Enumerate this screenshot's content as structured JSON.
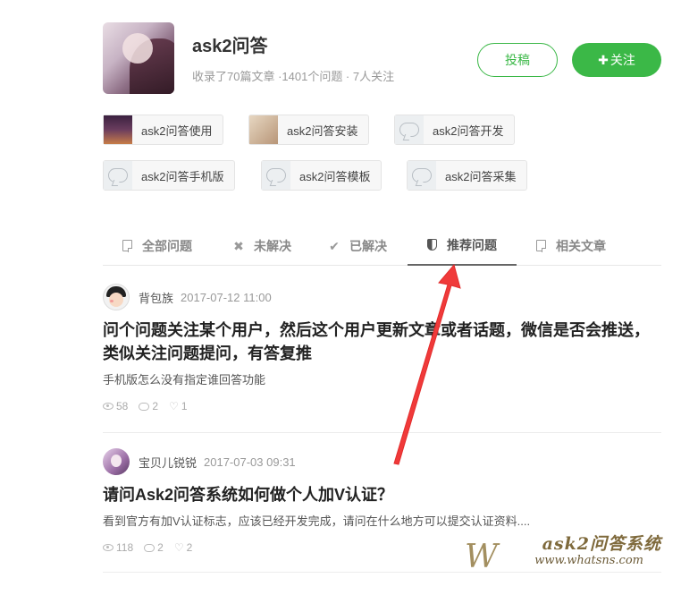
{
  "header": {
    "title": "ask2问答",
    "subtitle": "收录了70篇文章 ·1401个问题 · 7人关注",
    "contribute_label": "投稿",
    "follow_label": "关注",
    "follow_icon": "plus-icon"
  },
  "topics": [
    {
      "label": "ask2问答使用",
      "thumb": "night-scene"
    },
    {
      "label": "ask2问答安装",
      "thumb": "room-photo"
    },
    {
      "label": "ask2问答开发",
      "thumb": "chat-bubble-icon"
    },
    {
      "label": "ask2问答手机版",
      "thumb": "chat-bubble-icon"
    },
    {
      "label": "ask2问答模板",
      "thumb": "chat-bubble-icon"
    },
    {
      "label": "ask2问答采集",
      "thumb": "chat-bubble-icon"
    }
  ],
  "tabs": [
    {
      "label": "全部问题",
      "icon": "document-icon",
      "active": false
    },
    {
      "label": "未解决",
      "icon": "close-icon",
      "active": false
    },
    {
      "label": "已解决",
      "icon": "check-icon",
      "active": false
    },
    {
      "label": "推荐问题",
      "icon": "shield-icon",
      "active": true
    },
    {
      "label": "相关文章",
      "icon": "document-icon",
      "active": false
    }
  ],
  "questions": [
    {
      "author": "背包族",
      "time": "2017-07-12 11:00",
      "title_line1": "问个问题关注某个用户，然后这个用户更新文章或者话题，微信是否会推送，",
      "title_line2": "类似关注问题提问，有答复推",
      "desc": "手机版怎么没有指定谁回答功能",
      "views": "58",
      "comments": "2",
      "likes": "1"
    },
    {
      "author": "宝贝儿锐锐",
      "time": "2017-07-03 09:31",
      "title_line1": "请问Ask2问答系统如何做个人加V认证？",
      "desc": "看到官方有加V认证标志，应该已经开发完成，请问在什么地方可以提交认证资料....",
      "views": "118",
      "comments": "2",
      "likes": "2"
    }
  ],
  "watermark": {
    "main": "ask2问答系统",
    "url": "www.whatsns.com",
    "letter": "W"
  },
  "colors": {
    "accent_green": "#3bb847",
    "annotation_red": "#f03a3a"
  }
}
